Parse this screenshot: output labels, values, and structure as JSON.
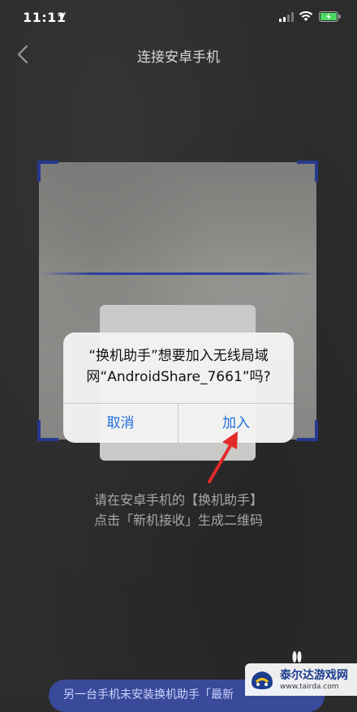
{
  "status_bar": {
    "time": "11:11"
  },
  "nav": {
    "title": "连接安卓手机"
  },
  "dialog": {
    "message_line1": "“换机助手”想要加入无线局域",
    "message_line2": "网“AndroidShare_7661”吗?",
    "cancel_label": "取消",
    "join_label": "加入"
  },
  "instructions": {
    "line1": "请在安卓手机的【换机助手】",
    "line2": "点击「新机接收」生成二维码"
  },
  "banner": {
    "text": "另一台手机未安装换机助手「最新"
  },
  "watermark": {
    "title": "泰尔达游戏网",
    "url": "www.tairda.com"
  },
  "colors": {
    "accent_blue": "#1f6fe0",
    "scanner_corner": "#27398f",
    "annotation_red": "#e32a2a",
    "background": "#2c2c2c"
  },
  "icons": [
    "location-arrow-icon",
    "cellular-signal-icon",
    "wifi-icon",
    "battery-charging-icon",
    "back-chevron-icon"
  ]
}
